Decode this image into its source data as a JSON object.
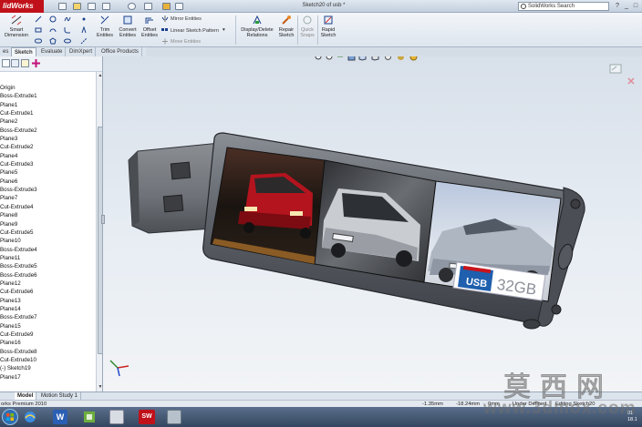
{
  "app": {
    "brand": "lidWorks",
    "document_title": "Sketch20 of usb *",
    "search_placeholder": "SolidWorks Search",
    "help": "?",
    "minimize": "_",
    "restore": "□",
    "close": "x"
  },
  "ribbon": {
    "smart_dimension": [
      "Smart",
      "Dimension"
    ],
    "trim_entities": [
      "Trim",
      "Entities"
    ],
    "convert_entities": [
      "Convert",
      "Entities"
    ],
    "offset_entities": [
      "Offset",
      "Entities"
    ],
    "mirror_entities": "Mirror Entities",
    "linear_sketch_pattern": "Linear Sketch Pattern",
    "move_entities": "Move Entities",
    "display_delete_relations": [
      "Display/Delete",
      "Relations"
    ],
    "repair_sketch": [
      "Repair",
      "Sketch"
    ],
    "quick_snaps": [
      "Quick",
      "Snaps"
    ],
    "rapid_sketch": [
      "Rapid",
      "Sketch"
    ]
  },
  "tabs": [
    "es",
    "Sketch",
    "Evaluate",
    "DimXpert",
    "Office Products"
  ],
  "tree": {
    "items": [
      "Origin",
      "Boss-Extrude1",
      "Plane1",
      "Cut-Extrude1",
      "Plane2",
      "Boss-Extrude2",
      "Plane3",
      "Cut-Extrude2",
      "Plane4",
      "Cut-Extrude3",
      "Plane5",
      "Plane6",
      "Boss-Extrude3",
      "Plane7",
      "Cut-Extrude4",
      "Plane8",
      "Plane9",
      "Cut-Extrude5",
      "Plane10",
      "Boss-Extrude4",
      "Plane11",
      "Boss-Extrude5",
      "Boss-Extrude6",
      "Plane12",
      "Cut-Extrude6",
      "Plane13",
      "Plane14",
      "Boss-Extrude7",
      "Plane15",
      "Cut-Extrude9",
      "Plane16",
      "Boss-Extrude8",
      "Cut-Extrude10",
      "(-) Sketch19",
      "Plane17"
    ]
  },
  "model": {
    "badge_text": "USB",
    "capacity": "32GB",
    "photo_panels": [
      "red-hatchback-photo",
      "silver-hatchback-photo",
      "silver-convertible-photo"
    ]
  },
  "bottom_tabs": [
    "Model",
    "Motion Study 1"
  ],
  "status": {
    "product": "orks Premium 2010",
    "x": "-1.35mm",
    "y": "-18.24mm",
    "z": "0mm",
    "definition": "Under Defined",
    "mode": "Editing Sketch20"
  },
  "taskbar": {
    "clock_line1": "01",
    "clock_line2": "18.1"
  },
  "watermark": {
    "chinese": "莫西网",
    "url": "www.3dmox.com"
  },
  "colors": {
    "sw_red": "#c0111a",
    "usb_body": "#5d6168",
    "usb_connector": "#6e7177",
    "viewport_top": "#d8e0ea"
  }
}
